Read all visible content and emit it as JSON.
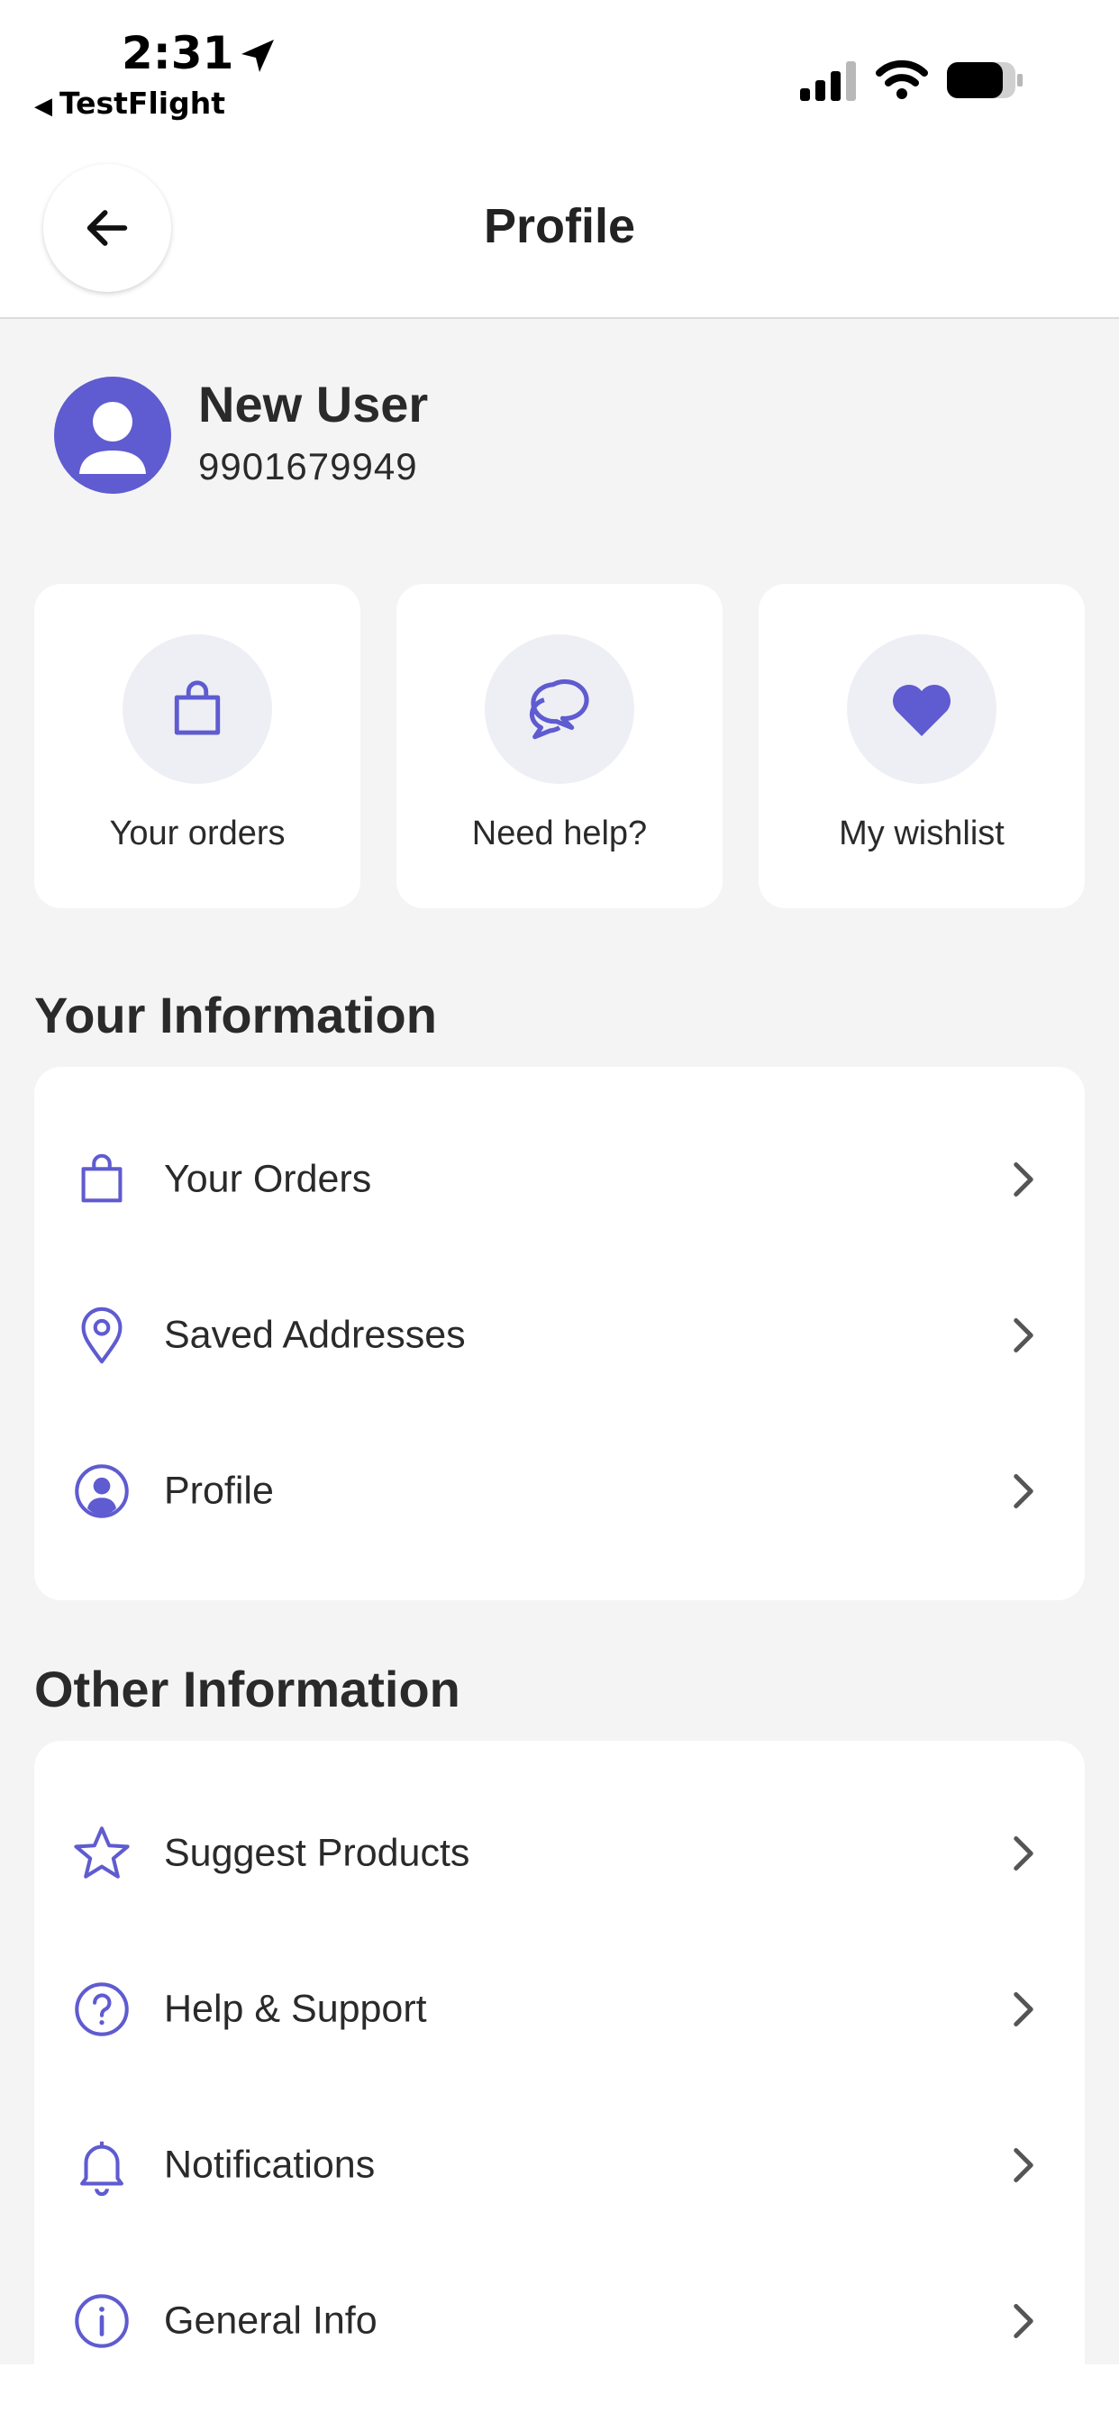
{
  "status_bar": {
    "time": "2:31",
    "back_app": "TestFlight"
  },
  "header": {
    "title": "Profile"
  },
  "user": {
    "name": "New User",
    "phone": "9901679949"
  },
  "quick_actions": [
    {
      "label": "Your orders",
      "icon": "shopping-bag-icon"
    },
    {
      "label": "Need help?",
      "icon": "chat-bubbles-icon"
    },
    {
      "label": "My wishlist",
      "icon": "heart-icon"
    }
  ],
  "your_information": {
    "title": "Your Information",
    "items": [
      {
        "label": "Your Orders",
        "icon": "shopping-bag-icon"
      },
      {
        "label": "Saved Addresses",
        "icon": "location-pin-icon"
      },
      {
        "label": "Profile",
        "icon": "user-circle-icon"
      }
    ]
  },
  "other_information": {
    "title": "Other Information",
    "items": [
      {
        "label": "Suggest Products",
        "icon": "star-icon"
      },
      {
        "label": "Help & Support",
        "icon": "question-circle-icon"
      },
      {
        "label": "Notifications",
        "icon": "bell-icon"
      },
      {
        "label": "General Info",
        "icon": "info-circle-icon"
      }
    ]
  },
  "colors": {
    "accent": "#5f5bd0",
    "background": "#f4f4f5",
    "card": "#ffffff",
    "icon_circle": "#eeeff5",
    "text": "#2a2a2a"
  }
}
